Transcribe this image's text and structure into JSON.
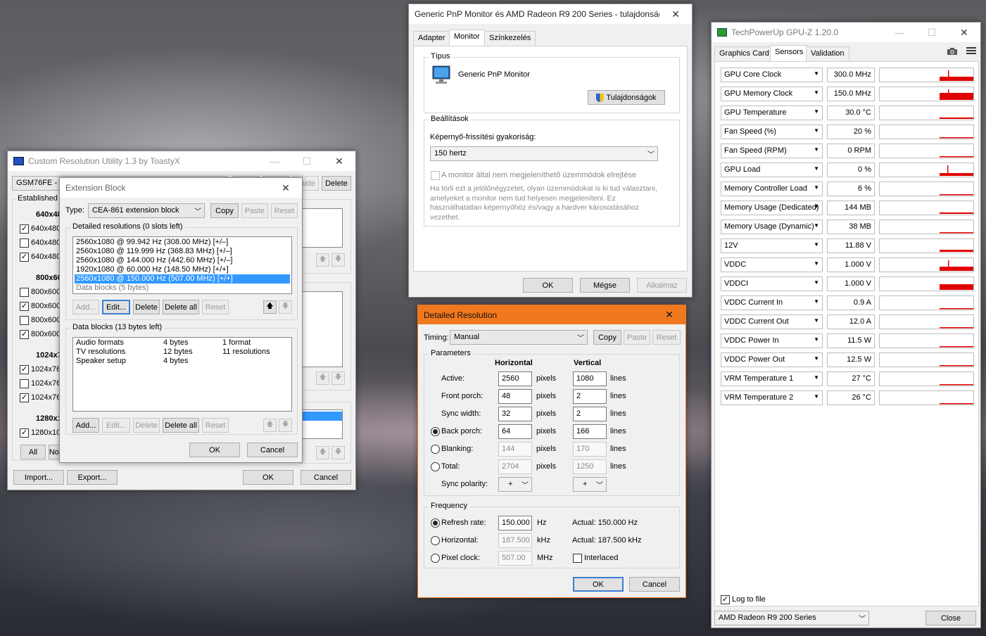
{
  "monitor_props": {
    "title": "Generic PnP Monitor és AMD Radeon R9 200 Series - tulajdonságok",
    "tabs": [
      "Adapter",
      "Monitor",
      "Színkezelés"
    ],
    "type_group": "Típus",
    "monitor_name": "Generic PnP Monitor",
    "properties_btn": "Tulajdonságok",
    "settings_group": "Beállítások",
    "refresh_label": "Képernyő-frissítési gyakoriság:",
    "refresh_value": "150 hertz",
    "hide_modes_label": "A monitor által nem megjeleníthető üzemmódok elrejtése",
    "hide_modes_desc": "Ha törli ezt a jelölőnégyzetet, olyan üzemmódokat is ki tud választani, amelyeket a monitor nem tud helyesen megjeleníteni. Ez használhatatlan képernyőhöz és/vagy a hardver károsodásához vezethet.",
    "ok": "OK",
    "cancel": "Mégse",
    "apply": "Alkalmaz"
  },
  "cru": {
    "title": "Custom Resolution Utility 1.3 by ToastyX",
    "monitor_select": "GSM76FE - LG",
    "paste": "Paste",
    "delete": "Delete",
    "established": "Established",
    "groups": [
      {
        "header": "640x480",
        "items": [
          {
            "label": "640x480",
            "checked": true
          },
          {
            "label": "640x480",
            "checked": false
          },
          {
            "label": "640x480",
            "checked": true
          }
        ]
      },
      {
        "header": "800x600",
        "items": [
          {
            "label": "800x600",
            "checked": false
          },
          {
            "label": "800x600",
            "checked": true
          },
          {
            "label": "800x600",
            "checked": false
          },
          {
            "label": "800x600",
            "checked": true
          }
        ]
      },
      {
        "header": "1024x768",
        "items": [
          {
            "label": "1024x768",
            "checked": true
          },
          {
            "label": "1024x768",
            "checked": false
          },
          {
            "label": "1024x768",
            "checked": true
          }
        ]
      },
      {
        "header": "1280x1024",
        "items": [
          {
            "label": "1280x1024",
            "checked": true
          }
        ]
      }
    ],
    "all": "All",
    "none": "None",
    "import": "Import...",
    "export": "Export...",
    "ok": "OK",
    "cancel": "Cancel"
  },
  "ext": {
    "title": "Extension Block",
    "type_label": "Type:",
    "type_value": "CEA-861 extension block",
    "copy": "Copy",
    "paste": "Paste",
    "reset": "Reset",
    "detailed_label": "Detailed resolutions (0 slots left)",
    "detailed": [
      "2560x1080 @ 99.942 Hz (308.00 MHz) [+/–]",
      "2560x1080 @ 119.999 Hz (368.83 MHz) [+/–]",
      "2560x1080 @ 144.000 Hz (442.60 MHz) [+/–]",
      "1920x1080 @ 60.000 Hz (148.50 MHz) [+/+]",
      "2560x1080 @ 150.000 Hz (507.00 MHz) [+/+]",
      "Data blocks (5 bytes)"
    ],
    "add": "Add...",
    "edit": "Edit...",
    "delete": "Delete",
    "delete_all": "Delete all",
    "data_label": "Data blocks (13 bytes left)",
    "data_blocks": [
      {
        "name": "Audio formats",
        "size": "4 bytes",
        "info": "1 format"
      },
      {
        "name": "TV resolutions",
        "size": "12 bytes",
        "info": "11 resolutions"
      },
      {
        "name": "Speaker setup",
        "size": "4 bytes",
        "info": ""
      }
    ],
    "ok": "OK",
    "cancel": "Cancel"
  },
  "detailed_res": {
    "title": "Detailed Resolution",
    "accent": "#f0781e",
    "timing_label": "Timing:",
    "timing_value": "Manual",
    "copy": "Copy",
    "paste": "Paste",
    "reset": "Reset",
    "params_group": "Parameters",
    "horizontal": "Horizontal",
    "vertical": "Vertical",
    "rows": [
      {
        "label": "Active:",
        "h": "2560",
        "hu": "pixels",
        "v": "1080",
        "vu": "lines",
        "radio": false,
        "disabled": false
      },
      {
        "label": "Front porch:",
        "h": "48",
        "hu": "pixels",
        "v": "2",
        "vu": "lines",
        "radio": false,
        "disabled": false
      },
      {
        "label": "Sync width:",
        "h": "32",
        "hu": "pixels",
        "v": "2",
        "vu": "lines",
        "radio": false,
        "disabled": false
      },
      {
        "label": "Back porch:",
        "h": "64",
        "hu": "pixels",
        "v": "166",
        "vu": "lines",
        "radio": true,
        "on": true,
        "disabled": false
      },
      {
        "label": "Blanking:",
        "h": "144",
        "hu": "pixels",
        "v": "170",
        "vu": "lines",
        "radio": true,
        "on": false,
        "disabled": true
      },
      {
        "label": "Total:",
        "h": "2704",
        "hu": "pixels",
        "v": "1250",
        "vu": "lines",
        "radio": true,
        "on": false,
        "disabled": true
      }
    ],
    "sync_label": "Sync polarity:",
    "sync_h": "+",
    "sync_v": "+",
    "freq_group": "Frequency",
    "refresh_label": "Refresh rate:",
    "refresh_value": "150.000",
    "refresh_unit": "Hz",
    "refresh_actual": "Actual: 150.000 Hz",
    "hfreq_label": "Horizontal:",
    "hfreq_value": "187.500",
    "hfreq_unit": "kHz",
    "hfreq_actual": "Actual: 187.500 kHz",
    "pclk_label": "Pixel clock:",
    "pclk_value": "507.00",
    "pclk_unit": "MHz",
    "interlaced": "Interlaced",
    "ok": "OK",
    "cancel": "Cancel"
  },
  "gpuz": {
    "title": "TechPowerUp GPU-Z 1.20.0",
    "tabs": [
      "Graphics Card",
      "Sensors",
      "Validation"
    ],
    "sensors": [
      {
        "name": "GPU Core Clock",
        "value": "300.0 MHz"
      },
      {
        "name": "GPU Memory Clock",
        "value": "150.0 MHz"
      },
      {
        "name": "GPU Temperature",
        "value": "30.0 °C"
      },
      {
        "name": "Fan Speed (%)",
        "value": "20 %"
      },
      {
        "name": "Fan Speed (RPM)",
        "value": "0 RPM"
      },
      {
        "name": "GPU Load",
        "value": "0 %"
      },
      {
        "name": "Memory Controller Load",
        "value": "6 %"
      },
      {
        "name": "Memory Usage (Dedicated)",
        "value": "144 MB"
      },
      {
        "name": "Memory Usage (Dynamic)",
        "value": "38 MB"
      },
      {
        "name": "12V",
        "value": "11.88 V"
      },
      {
        "name": "VDDC",
        "value": "1.000 V"
      },
      {
        "name": "VDDCI",
        "value": "1.000 V"
      },
      {
        "name": "VDDC Current In",
        "value": "0.9 A"
      },
      {
        "name": "VDDC Current Out",
        "value": "12.0 A"
      },
      {
        "name": "VDDC Power In",
        "value": "11.5 W"
      },
      {
        "name": "VDDC Power Out",
        "value": "12.5 W"
      },
      {
        "name": "VRM Temperature 1",
        "value": "27 °C"
      },
      {
        "name": "VRM Temperature 2",
        "value": "26 °C"
      }
    ],
    "log_to_file": "Log to file",
    "gpu_select": "AMD Radeon R9 200 Series",
    "close": "Close",
    "graph_color": "#e00000"
  }
}
